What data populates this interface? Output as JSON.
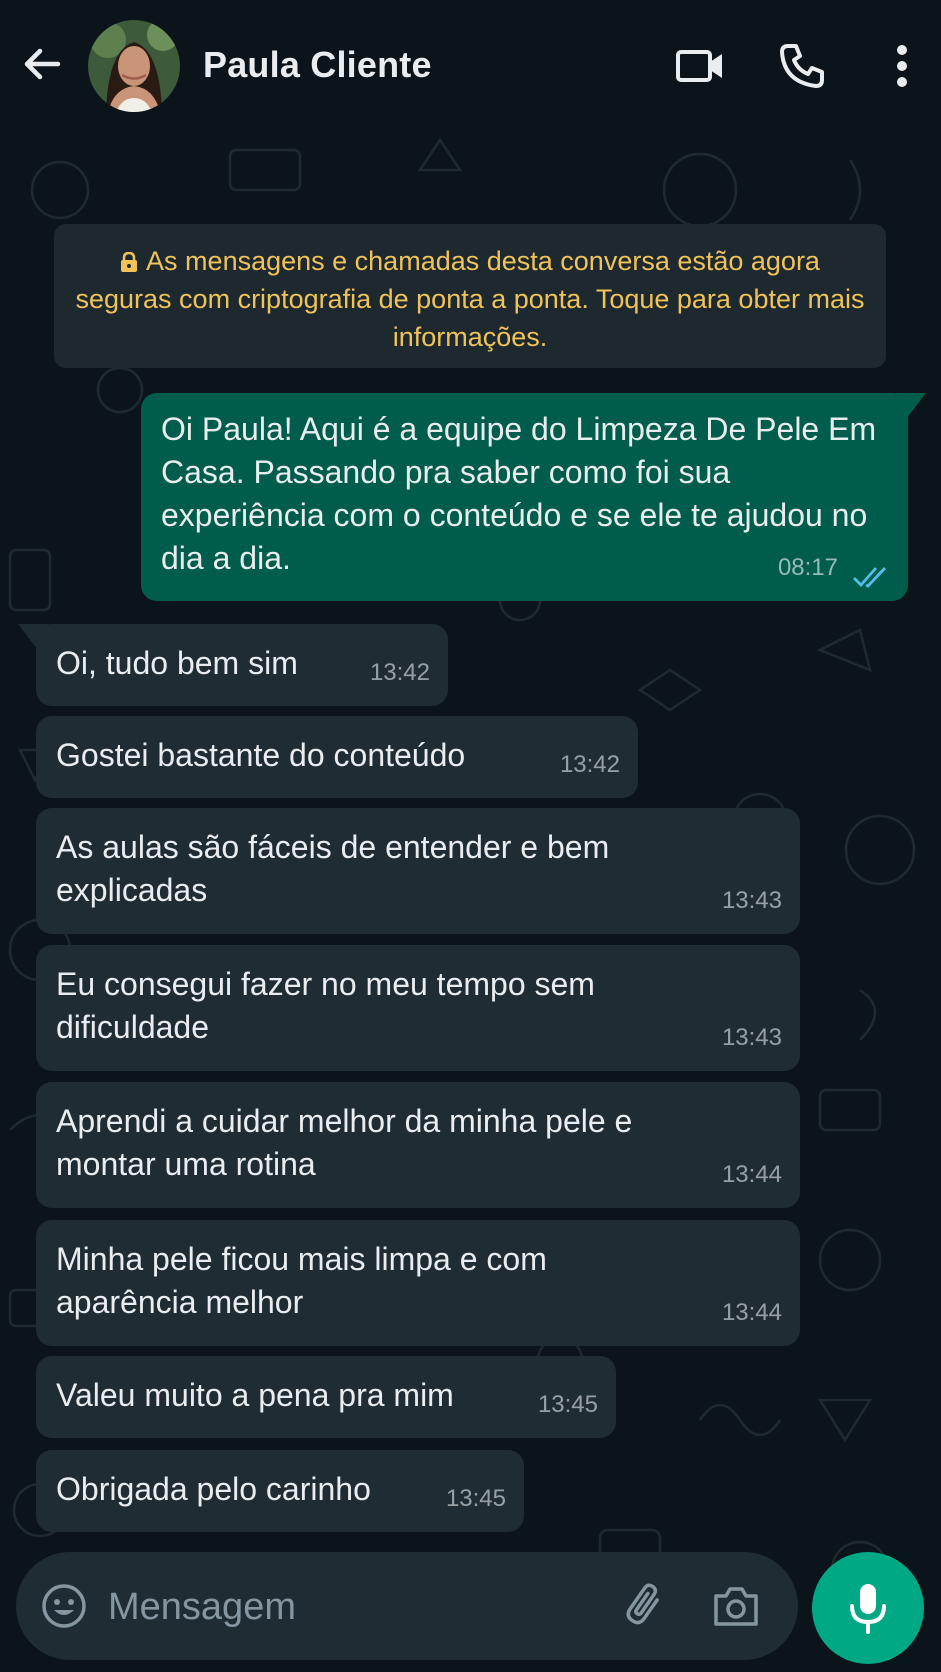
{
  "header": {
    "contact_name": "Paula Cliente"
  },
  "notice": {
    "text": "As mensagens e chamadas desta conversa estão agora seguras com criptografia de ponta a ponta. Toque para obter mais informações."
  },
  "messages": [
    {
      "direction": "out",
      "text": "Oi Paula! Aqui é a equipe do Limpeza De Pele Em Casa. Passando pra saber como foi sua experiência com o conteúdo e se ele te ajudou no dia a dia.",
      "time": "08:17",
      "status": "read"
    },
    {
      "direction": "in",
      "text": "Oi, tudo bem sim",
      "time": "13:42"
    },
    {
      "direction": "in",
      "text": "Gostei bastante do conteúdo",
      "time": "13:42"
    },
    {
      "direction": "in",
      "text": "As aulas são fáceis de entender e bem explicadas",
      "time": "13:43"
    },
    {
      "direction": "in",
      "text": "Eu consegui fazer no meu tempo sem dificuldade",
      "time": "13:43"
    },
    {
      "direction": "in",
      "text": "Aprendi a cuidar melhor da minha pele e montar uma rotina",
      "time": "13:44"
    },
    {
      "direction": "in",
      "text": "Minha pele ficou mais limpa e com aparência melhor",
      "time": "13:44"
    },
    {
      "direction": "in",
      "text": "Valeu muito a pena pra mim",
      "time": "13:45"
    },
    {
      "direction": "in",
      "text": "Obrigada pelo carinho",
      "time": "13:45"
    }
  ],
  "composer": {
    "placeholder": "Mensagem"
  },
  "colors": {
    "background": "#0b141a",
    "incoming_bubble": "#1f2c34",
    "outgoing_bubble": "#005c4b",
    "accent": "#00a884",
    "notice_text": "#f0c35a",
    "read_ticks": "#53bdeb"
  },
  "icons": {
    "back": "arrow-left-icon",
    "video": "video-camera-icon",
    "call": "phone-icon",
    "menu": "more-vertical-icon",
    "lock": "lock-icon",
    "emoji": "emoji-icon",
    "attach": "paperclip-icon",
    "camera": "camera-icon",
    "mic": "microphone-icon"
  }
}
